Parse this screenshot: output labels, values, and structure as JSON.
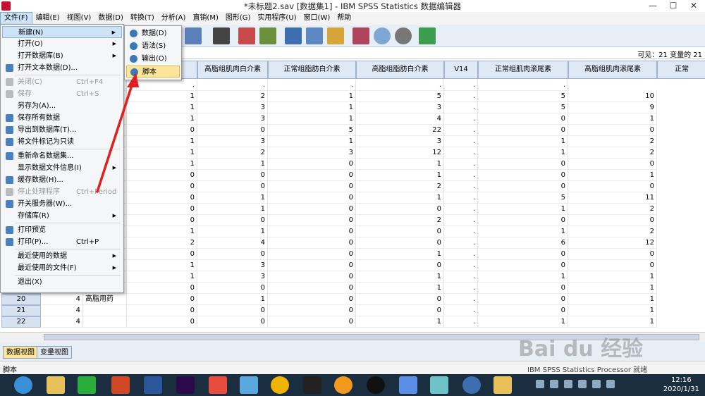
{
  "window": {
    "title": "*未标题2.sav [数据集1] - IBM SPSS Statistics 数据编辑器",
    "minimize": "—",
    "maximize": "☐",
    "close": "✕"
  },
  "menubar": [
    "文件(F)",
    "编辑(E)",
    "视图(V)",
    "数据(D)",
    "转换(T)",
    "分析(A)",
    "直销(M)",
    "图形(G)",
    "实用程序(U)",
    "窗口(W)",
    "帮助"
  ],
  "info": {
    "visible": "可见：21 变量的 21"
  },
  "columns": [
    "高脂组肌肉白介素",
    "正常组脂肪白介素",
    "高脂组脂肪白介素",
    "V14",
    "正常组肌肉滚尾素",
    "高脂组肌肉滚尾素",
    "正常"
  ],
  "rows": [
    {
      "n": "",
      "a": "",
      "b": "",
      "c": ".",
      "d": ".",
      "e": ".",
      "v": ".",
      "f": ".",
      "g": "."
    },
    {
      "n": "",
      "a": "",
      "b": "",
      "c": "1",
      "d": "2",
      "e": "1",
      "f": "5",
      "v": ".",
      "g": "5",
      "h": "10"
    },
    {
      "n": "",
      "a": "",
      "b": "",
      "c": "1",
      "d": "3",
      "e": "1",
      "f": "3",
      "v": ".",
      "g": "5",
      "h": "9"
    },
    {
      "n": "",
      "a": "",
      "b": "",
      "c": "1",
      "d": "3",
      "e": "1",
      "f": "4",
      "v": ".",
      "g": "0",
      "h": "1"
    },
    {
      "n": "",
      "a": "",
      "b": "",
      "c": "0",
      "d": "0",
      "e": "5",
      "f": "22",
      "v": ".",
      "g": "0",
      "h": "0"
    },
    {
      "n": "",
      "a": "",
      "b": "",
      "c": "1",
      "d": "3",
      "e": "1",
      "f": "3",
      "v": ".",
      "g": "1",
      "h": "2"
    },
    {
      "n": "",
      "a": "",
      "b": "",
      "c": "1",
      "d": "2",
      "e": "3",
      "f": "12",
      "v": ".",
      "g": "1",
      "h": "2"
    },
    {
      "n": "",
      "a": "",
      "b": "",
      "c": "1",
      "d": "1",
      "e": "0",
      "f": "1",
      "v": ".",
      "g": "0",
      "h": "0"
    },
    {
      "n": "",
      "a": "",
      "b": "",
      "c": "0",
      "d": "0",
      "e": "0",
      "f": "1",
      "v": ".",
      "g": "0",
      "h": "1"
    },
    {
      "n": "",
      "a": "",
      "b": "",
      "c": "0",
      "d": "0",
      "e": "0",
      "f": "2",
      "v": ".",
      "g": "0",
      "h": "0"
    },
    {
      "n": "",
      "a": "",
      "b": "",
      "c": "0",
      "d": "1",
      "e": "0",
      "f": "1",
      "v": ".",
      "g": "5",
      "h": "11"
    },
    {
      "n": "",
      "a": "",
      "b": "",
      "c": "0",
      "d": "1",
      "e": "0",
      "f": "0",
      "v": ".",
      "g": "1",
      "h": "2"
    },
    {
      "n": "",
      "a": "",
      "b": "",
      "c": "0",
      "d": "0",
      "e": "0",
      "f": "2",
      "v": ".",
      "g": "0",
      "h": "0"
    },
    {
      "n": "",
      "a": "",
      "b": "",
      "c": "1",
      "d": "1",
      "e": "0",
      "f": "0",
      "v": ".",
      "g": "1",
      "h": "2"
    },
    {
      "n": "",
      "a": "",
      "b": "",
      "c": "2",
      "d": "4",
      "e": "0",
      "f": "0",
      "v": ".",
      "g": "6",
      "h": "12"
    },
    {
      "n": "",
      "a": "",
      "b": "",
      "c": "0",
      "d": "0",
      "e": "0",
      "f": "1",
      "v": ".",
      "g": "0",
      "h": "0"
    },
    {
      "n": "",
      "a": "",
      "b": "",
      "c": "1",
      "d": "3",
      "e": "0",
      "f": "0",
      "v": ".",
      "g": "0",
      "h": "0"
    },
    {
      "n": "",
      "a": "",
      "b": "",
      "c": "1",
      "d": "3",
      "e": "0",
      "f": "1",
      "v": ".",
      "g": "1",
      "h": "1"
    },
    {
      "n": "",
      "a": "",
      "b": "",
      "c": "0",
      "d": "0",
      "e": "0",
      "f": "1",
      "v": ".",
      "g": "0",
      "h": "1"
    },
    {
      "n": "20",
      "a": "4",
      "b": "高脂用药",
      "c": "0",
      "d": "1",
      "e": "0",
      "f": "0",
      "v": ".",
      "g": "0",
      "h": "1"
    },
    {
      "n": "21",
      "a": "4",
      "b": "",
      "c": "0",
      "d": "0",
      "e": "0",
      "f": "0",
      "v": ".",
      "g": "0",
      "h": "1"
    },
    {
      "n": "22",
      "a": "4",
      "b": "",
      "c": "0",
      "d": "0",
      "e": "0",
      "f": "1",
      "v": ".",
      "g": "1",
      "h": "1"
    }
  ],
  "file_menu": [
    {
      "label": "新建(N)",
      "arrow": "▶",
      "hl": true
    },
    {
      "label": "打开(O)",
      "arrow": "▶"
    },
    {
      "label": "打开数据库(B)",
      "arrow": "▶"
    },
    {
      "label": "打开文本数据(D)...",
      "icon": true
    },
    {
      "sep": true
    },
    {
      "label": "关闭(C)",
      "shortcut": "Ctrl+F4",
      "dis": true,
      "icon": true
    },
    {
      "label": "保存",
      "shortcut": "Ctrl+S",
      "dis": true,
      "icon": true
    },
    {
      "label": "另存为(A)..."
    },
    {
      "label": "保存所有数据",
      "icon": true
    },
    {
      "label": "导出到数据库(T)...",
      "icon": true
    },
    {
      "label": "将文件标记为只读",
      "icon": true
    },
    {
      "sep": true
    },
    {
      "label": "重新命名数据集...",
      "icon": true
    },
    {
      "label": "显示数据文件信息(I)",
      "arrow": "▶"
    },
    {
      "label": "缓存数据(H)...",
      "icon": true
    },
    {
      "label": "停止处理程序",
      "shortcut": "Ctrl+Period",
      "dis": true,
      "icon": true
    },
    {
      "label": "开关服务器(W)...",
      "icon": true
    },
    {
      "label": "存储库(R)",
      "arrow": "▶"
    },
    {
      "sep": true
    },
    {
      "label": "打印预览",
      "icon": true
    },
    {
      "label": "打印(P)...",
      "shortcut": "Ctrl+P",
      "icon": true
    },
    {
      "sep": true
    },
    {
      "label": "最近使用的数据",
      "arrow": "▶"
    },
    {
      "label": "最近使用的文件(F)",
      "arrow": "▶"
    },
    {
      "sep": true
    },
    {
      "label": "退出(X)"
    }
  ],
  "submenu": [
    "数据(D)",
    "语法(S)",
    "输出(O)",
    "脚本"
  ],
  "tabs": {
    "data_view": "数据视图",
    "variable_view": "变量视图"
  },
  "status": {
    "left": "脚本",
    "right": "IBM SPSS Statistics Processor 就绪"
  },
  "clock": {
    "time": "12:16",
    "date": "2020/1/31"
  },
  "watermark": "Bai du 经验"
}
